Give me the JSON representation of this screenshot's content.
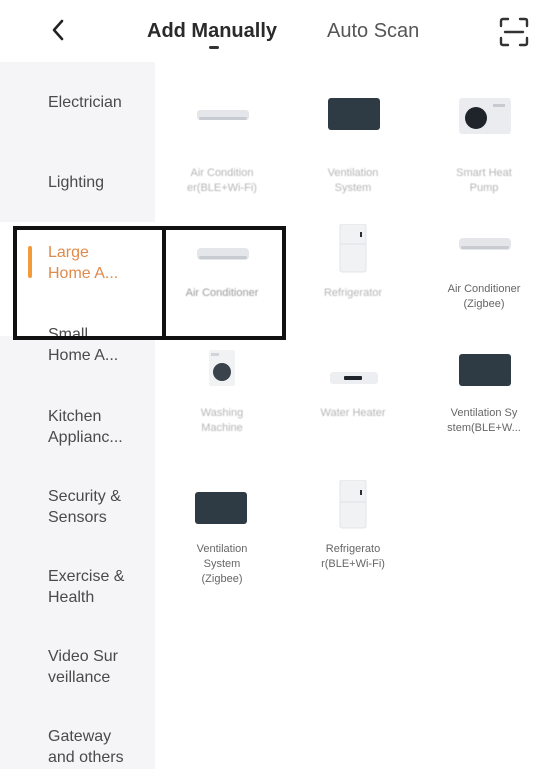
{
  "header": {
    "back_icon": "chevron-left-icon",
    "tab_add_manually": "Add Manually",
    "tab_auto_scan": "Auto Scan",
    "scan_icon": "scan-frame-icon"
  },
  "sidebar": {
    "items": [
      {
        "label": "Electrician"
      },
      {
        "label": "Lighting"
      },
      {
        "label": "Large\nHome A..."
      },
      {
        "label": "Small\nHome A..."
      },
      {
        "label": "Kitchen\nApplianc..."
      },
      {
        "label": "Security &\nSensors"
      },
      {
        "label": "Exercise &\nHealth"
      },
      {
        "label": "Video Sur\nveillance"
      },
      {
        "label": "Gateway\nand others"
      }
    ],
    "active_index": 2,
    "accent_color": "#f29b38"
  },
  "devices": [
    {
      "name": "Air Condition\ner(BLE+Wi-Fi)",
      "icon": "air-conditioner-icon"
    },
    {
      "name": "Ventilation\nSystem",
      "icon": "ventilation-icon"
    },
    {
      "name": "Smart Heat\nPump",
      "icon": "heat-pump-icon"
    },
    {
      "name": "Air Conditioner",
      "icon": "air-conditioner-icon"
    },
    {
      "name": "Refrigerator",
      "icon": "refrigerator-icon"
    },
    {
      "name": "Air Conditioner\n(Zigbee)",
      "icon": "air-conditioner-icon"
    },
    {
      "name": "Washing\nMachine",
      "icon": "washing-machine-icon"
    },
    {
      "name": "Water Heater",
      "icon": "water-heater-icon"
    },
    {
      "name": "Ventilation Sy\nstem(BLE+W...",
      "icon": "ventilation-icon"
    },
    {
      "name": "Ventilation\nSystem\n(Zigbee)",
      "icon": "ventilation-icon"
    },
    {
      "name": "Refrigerato\nr(BLE+Wi-Fi)",
      "icon": "refrigerator-icon"
    }
  ]
}
